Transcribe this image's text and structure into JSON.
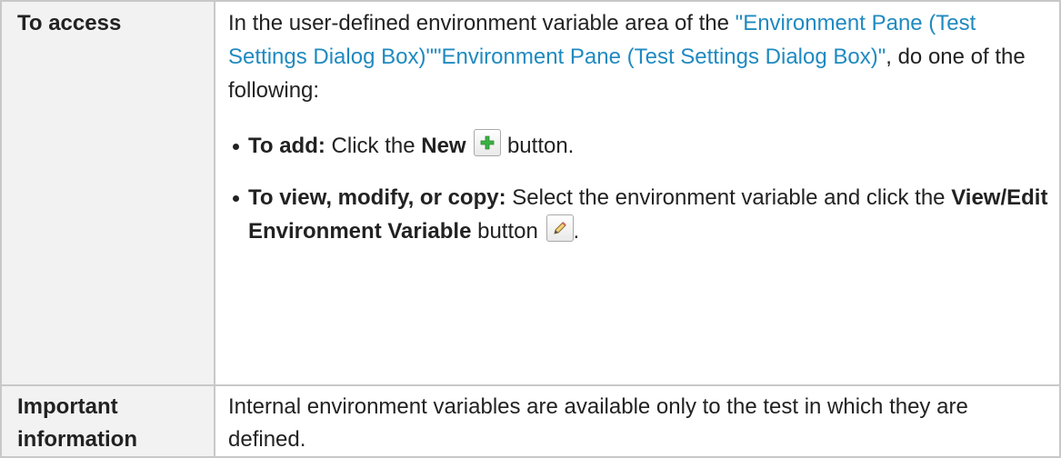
{
  "rows": {
    "access": {
      "label": "To access",
      "intro_prefix": "In the user-defined environment variable area of the ",
      "link_1": "\"Environment Pane (Test Settings Dialog Box)\"",
      "link_2": "\"Environment Pane (Test Settings Dialog Box)\"",
      "intro_suffix": ", do one of the following:",
      "items": [
        {
          "lead": "To add:",
          "text_1": " Click the ",
          "bold_1": "New",
          "icon": "add-plus-icon",
          "text_2": " button."
        },
        {
          "lead": "To view, modify, or copy:",
          "text_1": " Select the environment variable and click the ",
          "bold_1": "View/Edit Environment Variable",
          "text_2": " button",
          "icon": "pencil-edit-icon",
          "text_3": "."
        }
      ]
    },
    "important": {
      "label": "Important information",
      "text": "Internal environment variables are available only to the test in which they are defined."
    }
  },
  "colors": {
    "link": "#1f8ac0",
    "label_bg": "#f2f2f2",
    "border": "#c8c8c8",
    "plus_icon": "#3cb043"
  }
}
